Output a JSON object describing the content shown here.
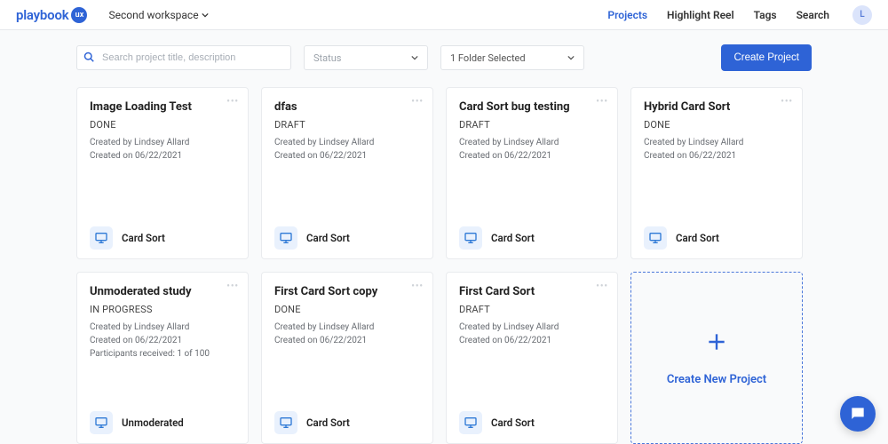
{
  "brand": {
    "name": "playbook",
    "badge": "ux"
  },
  "workspace": {
    "label": "Second workspace"
  },
  "nav": {
    "projects": "Projects",
    "highlight": "Highlight Reel",
    "tags": "Tags",
    "search": "Search",
    "avatar_initial": "L"
  },
  "controls": {
    "search_placeholder": "Search project title, description",
    "status_label": "Status",
    "folder_label": "1 Folder Selected",
    "create_label": "Create Project"
  },
  "projects": [
    {
      "title": "Image Loading Test",
      "status": "DONE",
      "created_by": "Created by Lindsey Allard",
      "created_on": "Created on 06/22/2021",
      "type": "Card Sort"
    },
    {
      "title": "dfas",
      "status": "DRAFT",
      "created_by": "Created by Lindsey Allard",
      "created_on": "Created on 06/22/2021",
      "type": "Card Sort"
    },
    {
      "title": "Card Sort bug testing",
      "status": "DRAFT",
      "created_by": "Created by Lindsey Allard",
      "created_on": "Created on 06/22/2021",
      "type": "Card Sort"
    },
    {
      "title": "Hybrid Card Sort",
      "status": "DONE",
      "created_by": "Created by Lindsey Allard",
      "created_on": "Created on 06/22/2021",
      "type": "Card Sort"
    },
    {
      "title": "Unmoderated study",
      "status": "IN PROGRESS",
      "created_by": "Created by Lindsey Allard",
      "created_on": "Created on 06/22/2021",
      "extra": "Participants received: 1 of 100",
      "type": "Unmoderated"
    },
    {
      "title": "First Card Sort copy",
      "status": "DONE",
      "created_by": "Created by Lindsey Allard",
      "created_on": "Created on 06/22/2021",
      "type": "Card Sort"
    },
    {
      "title": "First Card Sort",
      "status": "DRAFT",
      "created_by": "Created by Lindsey Allard",
      "created_on": "Created on 06/22/2021",
      "type": "Card Sort"
    }
  ],
  "new_project_label": "Create New Project"
}
